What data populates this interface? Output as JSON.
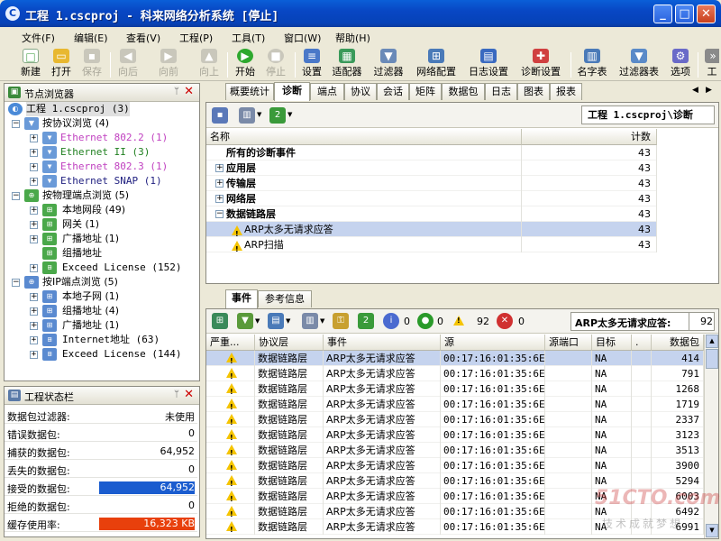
{
  "window": {
    "title": "工程 1.cscproj - 科来网络分析系统 [停止]"
  },
  "menu": [
    "文件(F)",
    "编辑(E)",
    "查看(V)",
    "工程(P)",
    "工具(T)",
    "窗口(W)",
    "帮助(H)"
  ],
  "toolbar": {
    "new": "新建",
    "open": "打开",
    "save": "保存",
    "back": "向后",
    "forward": "向前",
    "up": "向上",
    "start": "开始",
    "stop": "停止",
    "settings": "设置",
    "adapter": "适配器",
    "filter": "过滤器",
    "netconfig": "网络配置",
    "logsettings": "日志设置",
    "diagsettings": "诊断设置",
    "nametable": "名字表",
    "filtertable": "过滤器表",
    "options": "选项",
    "more": "工"
  },
  "node_browser": {
    "title": "节点浏览器",
    "pin": "ᛘ",
    "root": "工程 1.cscproj (3)",
    "protocol": "按协议浏览 (4)",
    "protocol_items": [
      "Ethernet 802.2 (1)",
      "Ethernet II (3)",
      "Ethernet 802.3 (1)",
      "Ethernet SNAP (1)"
    ],
    "physical": "按物理端点浏览 (5)",
    "physical_items": [
      "本地网段 (49)",
      "网关 (1)",
      "广播地址 (1)",
      "组播地址",
      "Exceed License (152)"
    ],
    "ip": "按IP端点浏览 (5)",
    "ip_items": [
      "本地子网 (1)",
      "组播地址 (4)",
      "广播地址 (1)",
      "Internet地址 (63)",
      "Exceed License (144)"
    ]
  },
  "project_status": {
    "title": "工程状态栏",
    "rows": [
      {
        "label": "数据包过滤器:",
        "value": "未使用"
      },
      {
        "label": "错误数据包:",
        "value": "0"
      },
      {
        "label": "捕获的数据包:",
        "value": "64,952"
      },
      {
        "label": "丢失的数据包:",
        "value": "0"
      },
      {
        "label": "接受的数据包:",
        "value": "64,952"
      },
      {
        "label": "拒绝的数据包:",
        "value": "0"
      },
      {
        "label": "缓存使用率:",
        "value": "16,323 KB"
      }
    ],
    "accepted_fill": 1.0,
    "buffer_fill": 1.0,
    "colors": {
      "accepted_bar": "#1a5ccf",
      "buffer_bar": "#e8400c"
    }
  },
  "tabs": [
    "概要统计",
    "诊断",
    "端点",
    "协议",
    "会话",
    "矩阵",
    "数据包",
    "日志",
    "图表",
    "报表"
  ],
  "diag": {
    "path": "工程 1.cscproj\\诊断",
    "col_name": "名称",
    "col_count": "计数",
    "rows": [
      {
        "name": "所有的诊断事件",
        "count": "43"
      },
      {
        "name": "应用层",
        "count": "43"
      },
      {
        "name": "传输层",
        "count": "43"
      },
      {
        "name": "网络层",
        "count": "43"
      },
      {
        "name": "数据链路层",
        "count": "43"
      },
      {
        "name": "ARP太多无请求应答",
        "count": "43"
      },
      {
        "name": "ARP扫描",
        "count": "43"
      }
    ]
  },
  "event_tabs": [
    "事件",
    "参考信息"
  ],
  "events": {
    "count_info": "0",
    "count_ok": "0",
    "count_warn": "92",
    "count_err": "0",
    "selected_label": "ARP太多无请求应答:",
    "selected_count": "92",
    "columns": [
      "严重...",
      "协议层",
      "事件",
      "源",
      "源端口",
      "目标",
      ".",
      "数据包"
    ],
    "layer": "数据链路层",
    "event": "ARP太多无请求应答",
    "source": "00:17:16:01:35:6E",
    "target": "NA",
    "packets": [
      "414",
      "791",
      "1268",
      "1719",
      "2337",
      "3123",
      "3513",
      "3900",
      "5294",
      "6003",
      "6492",
      "6991"
    ]
  },
  "watermark": {
    "brand": "51CTO.com",
    "slogan": "技术成就梦想"
  }
}
